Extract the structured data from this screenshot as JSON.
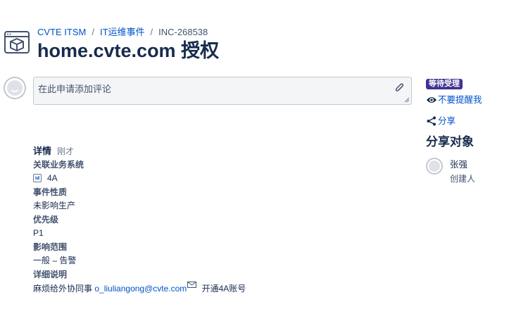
{
  "breadcrumb": {
    "items": [
      "CVTE ITSM",
      "IT运维事件",
      "INC-268538"
    ],
    "separator": "/"
  },
  "page": {
    "title": "home.cvte.com 授权"
  },
  "comment": {
    "placeholder": "在此申请添加评论"
  },
  "details": {
    "heading": "详情",
    "time": "刚才",
    "fields": [
      {
        "label": "关联业务系统",
        "value": "4A",
        "icon": "id-card-icon"
      },
      {
        "label": "事件性质",
        "value": "未影响生产"
      },
      {
        "label": "优先级",
        "value": "P1"
      },
      {
        "label": "影响范围",
        "value": "一般 – 告警"
      },
      {
        "label": "详细说明",
        "value_prefix": "麻烦给外协同事",
        "value_link": "o_liuliangong@cvte.com",
        "value_suffix": " 开通4A账号"
      }
    ]
  },
  "sidebar": {
    "status": "等待受理",
    "status_color": "#403294",
    "unwatch_label": "不要提醒我",
    "share_label": "分享",
    "share_heading": "分享对象",
    "people": [
      {
        "name": "张强",
        "role": "创建人"
      }
    ]
  },
  "icons": [
    "project-icon",
    "avatar-icon",
    "paperclip-icon",
    "id-card-icon",
    "mail-icon",
    "eye-icon",
    "share-icon"
  ],
  "colors": {
    "link": "#0052cc",
    "text": "#172b4d",
    "muted": "#6b778c"
  }
}
